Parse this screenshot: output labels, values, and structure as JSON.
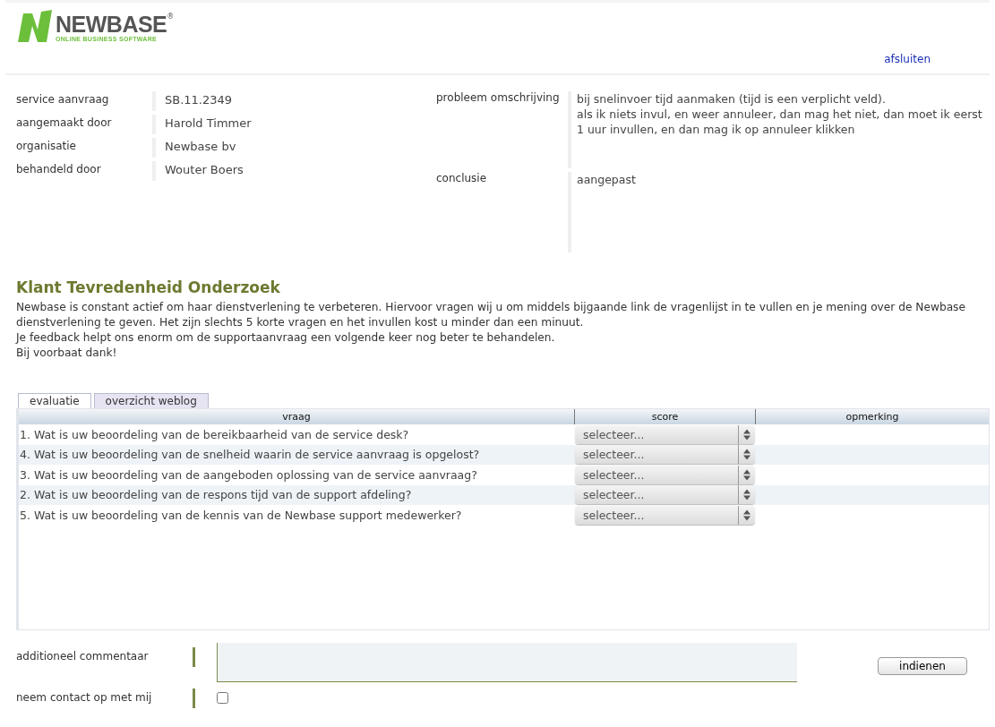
{
  "logo": {
    "name": "NEWBASE",
    "mark": "®",
    "tagline": "ONLINE BUSINESS SOFTWARE"
  },
  "header_link": "afsluiten",
  "details_left": [
    {
      "label": "service aanvraag",
      "value": "SB.11.2349"
    },
    {
      "label": "aangemaakt door",
      "value": "Harold Timmer"
    },
    {
      "label": "organisatie",
      "value": "Newbase bv"
    },
    {
      "label": "behandeld door",
      "value": "Wouter Boers"
    }
  ],
  "details_right": [
    {
      "label": "probleem omschrijving",
      "lines": [
        "bij snelinvoer tijd aanmaken (tijd is een verplicht veld).",
        "als ik niets invul, en weer annuleer, dan mag het niet, dan moet ik eerst 1 uur invullen, en dan mag ik op annuleer klikken"
      ]
    },
    {
      "label": "conclusie",
      "lines": [
        "aangepast"
      ]
    }
  ],
  "survey": {
    "title": "Klant Tevredenheid Onderzoek",
    "paragraphs": [
      "Newbase is constant actief om haar dienstverlening te verbeteren. Hiervoor vragen wij u om middels bijgaande link de vragenlijst in te vullen en je mening over de Newbase dienstverlening te geven. Het zijn slechts 5 korte vragen en het invullen kost u minder dan een minuut.",
      "Je feedback helpt ons enorm om de supportaanvraag een volgende keer nog beter te behandelen.",
      "Bij voorbaat dank!"
    ]
  },
  "tabs": [
    {
      "label": "evaluatie",
      "selected": true
    },
    {
      "label": "overzicht weblog",
      "selected": false
    }
  ],
  "table": {
    "columns": [
      "vraag",
      "score",
      "opmerking"
    ],
    "rows": [
      {
        "question": "1. Wat is uw beoordeling van de bereikbaarheid van de service desk?",
        "score": "selecteer..."
      },
      {
        "question": "4. Wat is uw beoordeling van de snelheid waarin de service aanvraag is opgelost?",
        "score": "selecteer..."
      },
      {
        "question": "3. Wat is uw beoordeling van de aangeboden oplossing van de service aanvraag?",
        "score": "selecteer..."
      },
      {
        "question": "2. Wat is uw beoordeling van de respons tijd van de support afdeling?",
        "score": "selecteer..."
      },
      {
        "question": "5. Wat is uw beoordeling van de kennis van de Newbase support medewerker?",
        "score": "selecteer..."
      }
    ]
  },
  "comment_label": "additioneel commentaar",
  "contact": {
    "label": "neem contact op met mij",
    "checked": false
  },
  "submit": "indienen"
}
